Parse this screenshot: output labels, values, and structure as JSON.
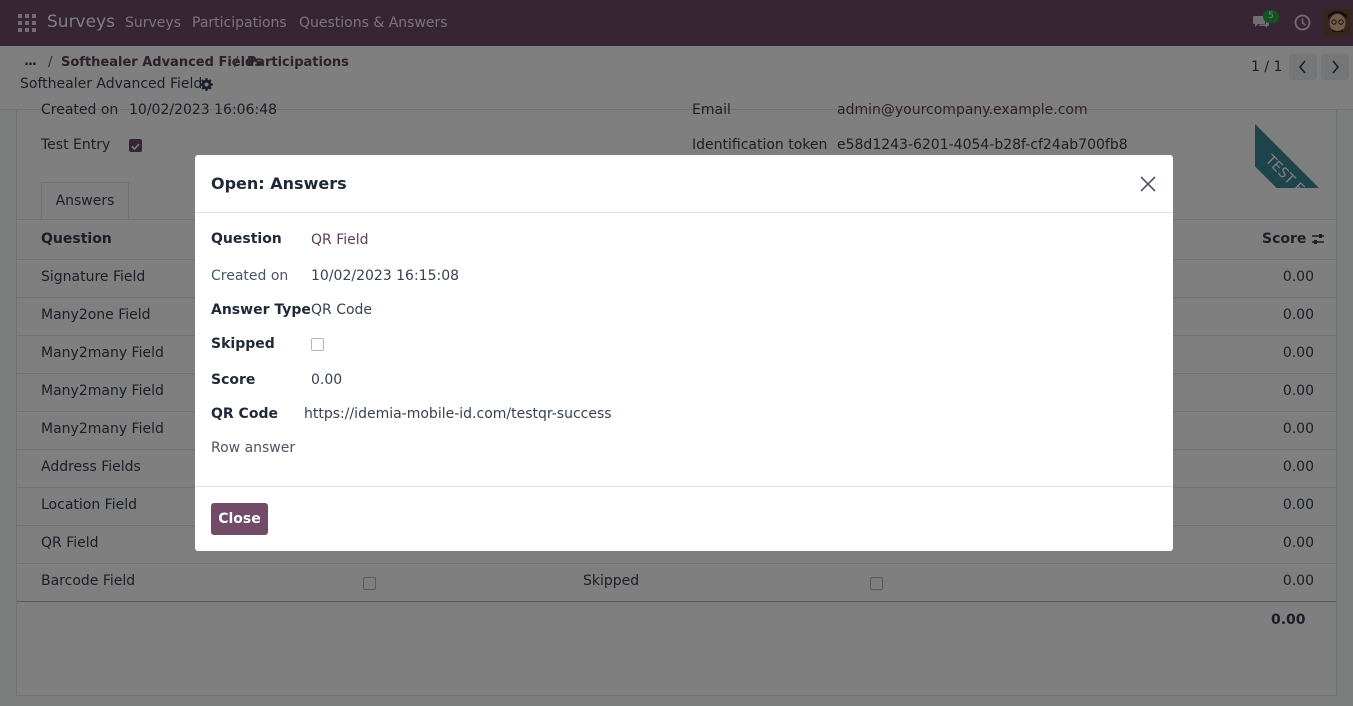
{
  "navbar": {
    "brand": "Surveys",
    "menu": [
      "Surveys",
      "Participations",
      "Questions & Answers"
    ],
    "chat_count": "5"
  },
  "breadcrumb": {
    "dots": "...",
    "sep": "/",
    "items": [
      "Softhealer Advanced Fields",
      "Participations"
    ]
  },
  "record_title": "Softhealer Advanced Fields",
  "pager": {
    "value": "1 / 1"
  },
  "form": {
    "created_on_label": "Created on",
    "created_on_value": "10/02/2023 16:06:48",
    "test_entry_label": "Test Entry",
    "email_label": "Email",
    "email_value": "admin@yourcompany.example.com",
    "token_label": "Identification token",
    "token_value": "e58d1243-6201-4054-b28f-cf24ab700fb8",
    "ribbon": "TEST ENTRY",
    "tab_answers": "Answers",
    "columns": {
      "question": "Question",
      "score": "Score"
    },
    "rows": [
      {
        "question": "Signature Field",
        "score": "0.00"
      },
      {
        "question": "Many2one Field",
        "score": "0.00"
      },
      {
        "question": "Many2many Field",
        "score": "0.00"
      },
      {
        "question": "Many2many Field",
        "score": "0.00"
      },
      {
        "question": "Many2many Field",
        "score": "0.00"
      },
      {
        "question": "Address Fields",
        "score": "0.00"
      },
      {
        "question": "Location Field",
        "score": "0.00"
      },
      {
        "question": "QR Field",
        "score": "0.00"
      },
      {
        "question": "Barcode Field",
        "score": "0.00",
        "skipped": "Skipped"
      }
    ],
    "total": "0.00"
  },
  "modal": {
    "title": "Open: Answers",
    "question_label": "Question",
    "question_value": "QR Field",
    "created_on_label": "Created on",
    "created_on_value": "10/02/2023 16:15:08",
    "answer_type_label": "Answer Type",
    "answer_type_value": "QR Code",
    "skipped_label": "Skipped",
    "score_label": "Score",
    "score_value": "0.00",
    "qr_code_label": "QR Code",
    "qr_code_value": "https://idemia-mobile-id.com/testqr-success",
    "row_answer_label": "Row answer",
    "close_button": "Close"
  },
  "colors": {
    "navbar": "#714b67",
    "primary": "#714b67",
    "link": "#5e3f57",
    "ribbon": "#3d8a97"
  }
}
